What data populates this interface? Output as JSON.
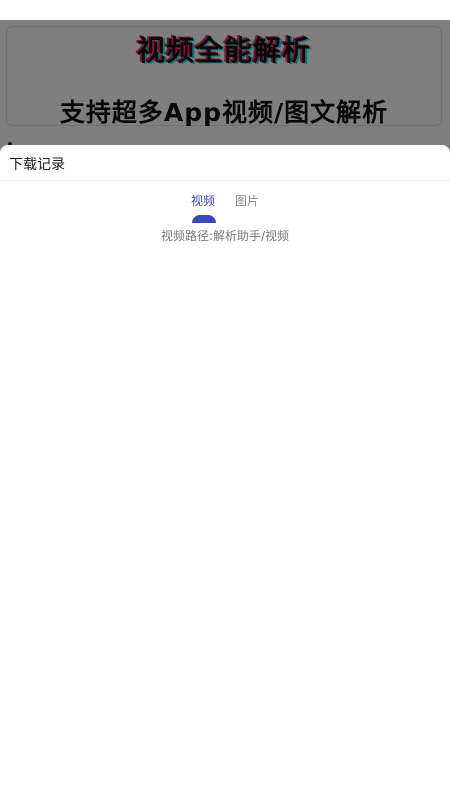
{
  "banner": {
    "title": "视频全能解析",
    "subtitle": "支持超多App视频/图文解析"
  },
  "sheet": {
    "title": "下载记录",
    "tabs": [
      {
        "label": "视频",
        "active": true
      },
      {
        "label": "图片",
        "active": false
      }
    ],
    "path_text": "视频路径:解析助手/视频"
  },
  "colors": {
    "accent": "#3b4ab8",
    "inactive_tab": "#8a8a8a",
    "overlay": "rgba(0,0,0,0.5)"
  }
}
